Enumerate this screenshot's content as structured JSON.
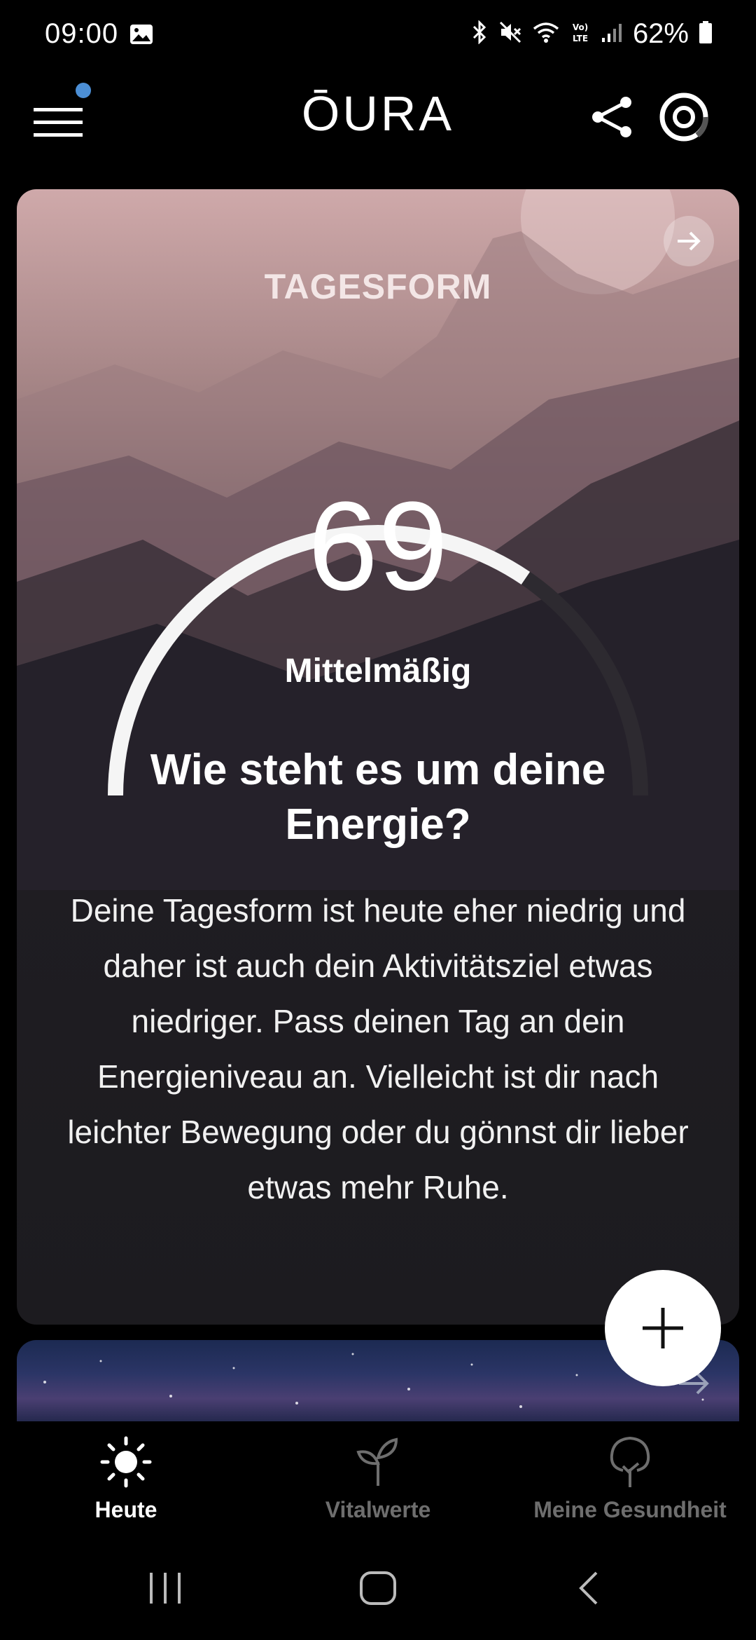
{
  "status_bar": {
    "time": "09:00",
    "battery": "62%",
    "icons": [
      "image-icon",
      "bluetooth-icon",
      "mute-icon",
      "wifi-icon",
      "volte-icon",
      "signal-icon",
      "battery-icon"
    ]
  },
  "header": {
    "logo": "ŌURA",
    "menu_icon": "menu-icon",
    "notification_dot_color": "#4c8fd6",
    "share_icon": "share-icon",
    "ring_icon": "ring-icon"
  },
  "readiness": {
    "label": "TAGESFORM",
    "score": "69",
    "score_fraction": 0.69,
    "rating": "Mittelmäßig",
    "headline": "Wie steht es um deine Energie?",
    "body": "Deine Tagesform ist heute eher niedrig und daher ist auch dein Aktivitätsziel etwas niedriger. Pass deinen Tag an dein Energieniveau an. Vielleicht ist dir nach leichter Bewegung oder du gönnst dir lieber etwas mehr Ruhe."
  },
  "fab": {
    "icon": "plus-icon"
  },
  "bottom_nav": {
    "items": [
      {
        "label": "Heute",
        "icon": "sun-icon",
        "active": true
      },
      {
        "label": "Vitalwerte",
        "icon": "sprout-icon",
        "active": false
      },
      {
        "label": "Meine Gesundheit",
        "icon": "tree-icon",
        "active": false
      }
    ]
  },
  "system_nav": {
    "icons": [
      "recents-icon",
      "home-icon",
      "back-icon"
    ]
  }
}
